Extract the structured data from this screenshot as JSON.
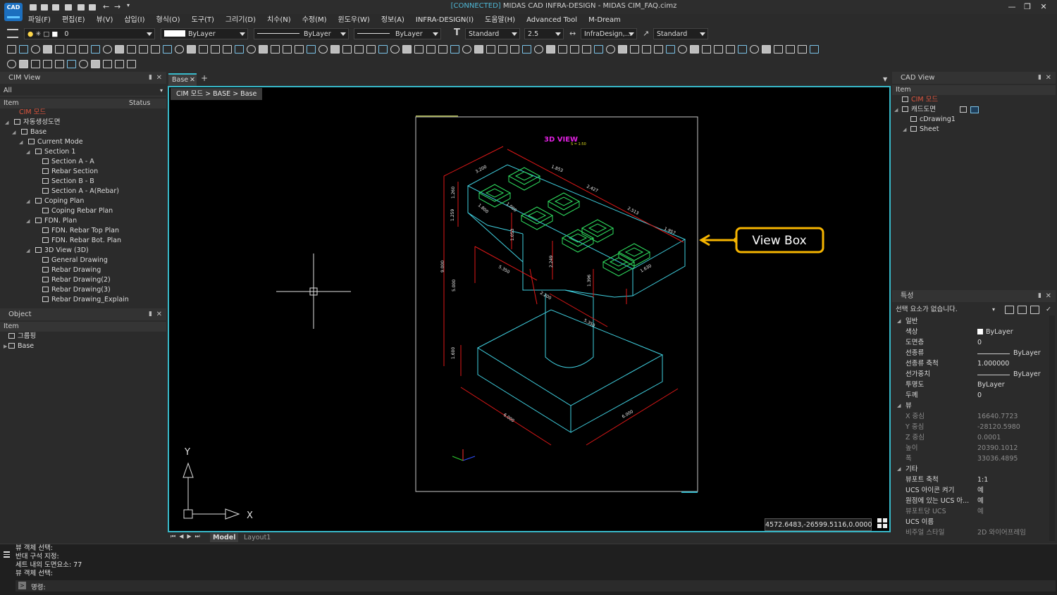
{
  "app": {
    "logo_text": "CAD",
    "title_connected": "[CONNECTED]",
    "title_rest": " MIDAS CAD INFRA-DESIGN - MIDAS CIM_FAQ.cimz"
  },
  "menu": [
    "파일(F)",
    "편집(E)",
    "뷰(V)",
    "삽입(I)",
    "형식(O)",
    "도구(T)",
    "그리기(D)",
    "치수(N)",
    "수정(M)",
    "윈도우(W)",
    "정보(A)",
    "INFRA-DESIGN(I)",
    "도움말(H)",
    "Advanced Tool",
    "M-Dream"
  ],
  "toolbar": {
    "layer_value": "0",
    "color_value": "ByLayer",
    "linetype_value": "ByLayer",
    "lineweight_value": "ByLayer",
    "textstyle_value": "Standard",
    "textsize_value": "2.5",
    "dimstyle_value": "InfraDesign,...",
    "tablestyle_value": "Standard"
  },
  "cim_view": {
    "title": "CIM View",
    "filter": "All",
    "col_item": "Item",
    "col_status": "Status",
    "items": [
      {
        "label": "CIM 모드",
        "level": 0,
        "red": true,
        "arrow": false
      },
      {
        "label": "자동생성도면",
        "level": 0,
        "arrow": true
      },
      {
        "label": "Base",
        "level": 1,
        "arrow": true
      },
      {
        "label": "Current Mode",
        "level": 2,
        "arrow": true
      },
      {
        "label": "Section 1",
        "level": 3,
        "arrow": true
      },
      {
        "label": "Section A - A",
        "level": 4,
        "arrow": false
      },
      {
        "label": "Rebar Section",
        "level": 4,
        "arrow": false
      },
      {
        "label": "Section B - B",
        "level": 4,
        "arrow": false
      },
      {
        "label": "Section A - A(Rebar)",
        "level": 4,
        "arrow": false
      },
      {
        "label": "Coping Plan",
        "level": 3,
        "arrow": true
      },
      {
        "label": "Coping Rebar Plan",
        "level": 4,
        "arrow": false
      },
      {
        "label": "FDN. Plan",
        "level": 3,
        "arrow": true
      },
      {
        "label": "FDN. Rebar Top Plan",
        "level": 4,
        "arrow": false
      },
      {
        "label": "FDN. Rebar Bot. Plan",
        "level": 4,
        "arrow": false
      },
      {
        "label": "3D View (3D)",
        "level": 3,
        "arrow": true
      },
      {
        "label": "General Drawing",
        "level": 4,
        "arrow": false
      },
      {
        "label": "Rebar Drawing",
        "level": 4,
        "arrow": false
      },
      {
        "label": "Rebar Drawing(2)",
        "level": 4,
        "arrow": false
      },
      {
        "label": "Rebar Drawing(3)",
        "level": 4,
        "arrow": false
      },
      {
        "label": "Rebar Drawing_Explain",
        "level": 4,
        "arrow": false
      }
    ]
  },
  "object_panel": {
    "title": "Object",
    "col_item": "Item",
    "items": [
      {
        "label": "그룹핑",
        "arrow": false
      },
      {
        "label": "Base",
        "arrow": true
      }
    ]
  },
  "doc_tab": {
    "label": "Base"
  },
  "breadcrumb": "CIM 모드 > BASE > Base",
  "drawing": {
    "view_title": "3D VIEW",
    "view_scale": "S = 1:50",
    "dims": [
      "3.200",
      "1.853",
      "2.427",
      "2.513",
      "1.957",
      "1.260",
      "1.800",
      "1.000",
      "1.259",
      "1.053",
      "5.350",
      "2.249",
      "2.200",
      "9.000",
      "5.000",
      "1.396",
      "5.350",
      "1.600",
      "6.000",
      "6.000",
      "1.630"
    ],
    "callout": "View Box",
    "ucs_x": "X",
    "ucs_y": "Y"
  },
  "coords": "4572.6483,-26599.5116,0.0000",
  "layout_tabs": {
    "model": "Model",
    "layout1": "Layout1"
  },
  "cad_view": {
    "title": "CAD View",
    "col_item": "Item",
    "items": [
      {
        "label": "CIM 모드",
        "red": true,
        "level": 0
      },
      {
        "label": "캐드도면",
        "level": 0,
        "arrow": true
      },
      {
        "label": "cDrawing1",
        "level": 1
      },
      {
        "label": "Sheet",
        "level": 1,
        "arrow": true
      }
    ]
  },
  "properties": {
    "title": "특성",
    "selection": "선택 요소가 없습니다.",
    "sections": [
      {
        "name": "일반",
        "rows": [
          {
            "k": "색상",
            "v": "ByLayer",
            "swatch": true
          },
          {
            "k": "도면층",
            "v": "0"
          },
          {
            "k": "선종류",
            "v": "ByLayer",
            "line": true
          },
          {
            "k": "선종류 축척",
            "v": "1.000000"
          },
          {
            "k": "선가중치",
            "v": "ByLayer",
            "line": true
          },
          {
            "k": "투명도",
            "v": "ByLayer"
          },
          {
            "k": "두께",
            "v": "0"
          }
        ]
      },
      {
        "name": "뷰",
        "rows": [
          {
            "k": "X 중심",
            "v": "16640.7723",
            "dim": true
          },
          {
            "k": "Y 중심",
            "v": "-28120.5980",
            "dim": true
          },
          {
            "k": "Z 중심",
            "v": "0.0001",
            "dim": true
          },
          {
            "k": "높이",
            "v": "20390.1012",
            "dim": true
          },
          {
            "k": "폭",
            "v": "33036.4895",
            "dim": true
          }
        ]
      },
      {
        "name": "기타",
        "rows": [
          {
            "k": "뷰포트 축척",
            "v": "1:1"
          },
          {
            "k": "UCS 아이콘 켜기",
            "v": "예"
          },
          {
            "k": "원점에 있는 UCS 아...",
            "v": "예"
          },
          {
            "k": "뷰포트당 UCS",
            "v": "예",
            "dim": true
          },
          {
            "k": "UCS 이름",
            "v": ""
          },
          {
            "k": "비주얼 스타일",
            "v": "2D 와이어프레임",
            "dim": true
          }
        ]
      }
    ]
  },
  "command": {
    "history": [
      "뷰 객체 선택:",
      "반대 구석 지정:",
      "세트 내의 도면요소: 77",
      "뷰 객체 선택:"
    ],
    "prompt": "명령:"
  },
  "colors": {
    "accent": "#38b8c8",
    "callout": "#f5b400",
    "cyan_line": "#40d0e0",
    "red_dim": "#e01818"
  }
}
